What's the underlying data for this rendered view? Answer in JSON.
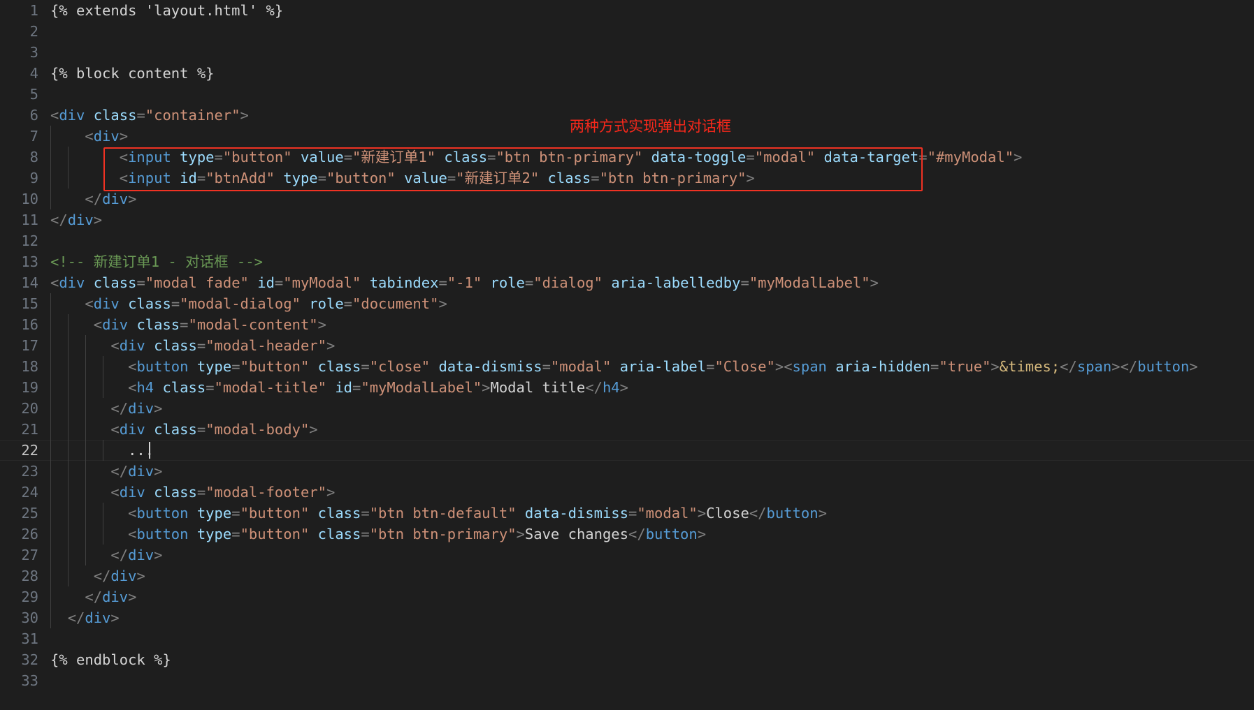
{
  "editor": {
    "theme_background": "#1e1e1e",
    "active_line_number": 22,
    "first_line": 1,
    "last_line": 33,
    "font_size_px": 20.5,
    "line_height_px": 30
  },
  "annotation": {
    "text": "两种方式实现弹出对话框",
    "color": "#f5281b",
    "box_color": "#f03223",
    "box_covers_lines": [
      8,
      9
    ]
  },
  "lines": [
    {
      "n": "1",
      "segments": [
        {
          "t": "{% extends 'layout.html' %}",
          "c": "jinja"
        }
      ]
    },
    {
      "n": "2",
      "segments": []
    },
    {
      "n": "3",
      "segments": []
    },
    {
      "n": "4",
      "segments": [
        {
          "t": "{% block content %}",
          "c": "jinja"
        }
      ]
    },
    {
      "n": "5",
      "segments": []
    },
    {
      "n": "6",
      "segments": [
        {
          "t": "<",
          "c": "punct"
        },
        {
          "t": "div",
          "c": "tag"
        },
        {
          "t": " ",
          "c": "txt"
        },
        {
          "t": "class",
          "c": "attr"
        },
        {
          "t": "=",
          "c": "punct"
        },
        {
          "t": "\"container\"",
          "c": "str"
        },
        {
          "t": ">",
          "c": "punct"
        }
      ]
    },
    {
      "n": "7",
      "segments": [
        {
          "t": "    ",
          "c": "txt"
        },
        {
          "t": "<",
          "c": "punct"
        },
        {
          "t": "div",
          "c": "tag"
        },
        {
          "t": ">",
          "c": "punct"
        }
      ]
    },
    {
      "n": "8",
      "segments": [
        {
          "t": "        ",
          "c": "txt"
        },
        {
          "t": "<",
          "c": "punct"
        },
        {
          "t": "input",
          "c": "tag"
        },
        {
          "t": " ",
          "c": "txt"
        },
        {
          "t": "type",
          "c": "attr"
        },
        {
          "t": "=",
          "c": "punct"
        },
        {
          "t": "\"button\"",
          "c": "str"
        },
        {
          "t": " ",
          "c": "txt"
        },
        {
          "t": "value",
          "c": "attr"
        },
        {
          "t": "=",
          "c": "punct"
        },
        {
          "t": "\"新建订单1\"",
          "c": "str"
        },
        {
          "t": " ",
          "c": "txt"
        },
        {
          "t": "class",
          "c": "attr"
        },
        {
          "t": "=",
          "c": "punct"
        },
        {
          "t": "\"btn btn-primary\"",
          "c": "str"
        },
        {
          "t": " ",
          "c": "txt"
        },
        {
          "t": "data-toggle",
          "c": "attr"
        },
        {
          "t": "=",
          "c": "punct"
        },
        {
          "t": "\"modal\"",
          "c": "str"
        },
        {
          "t": " ",
          "c": "txt"
        },
        {
          "t": "data-target",
          "c": "attr"
        },
        {
          "t": "=",
          "c": "punct"
        },
        {
          "t": "\"#myModal\"",
          "c": "str"
        },
        {
          "t": ">",
          "c": "punct"
        }
      ]
    },
    {
      "n": "9",
      "segments": [
        {
          "t": "        ",
          "c": "txt"
        },
        {
          "t": "<",
          "c": "punct"
        },
        {
          "t": "input",
          "c": "tag"
        },
        {
          "t": " ",
          "c": "txt"
        },
        {
          "t": "id",
          "c": "attr"
        },
        {
          "t": "=",
          "c": "punct"
        },
        {
          "t": "\"btnAdd\"",
          "c": "str"
        },
        {
          "t": " ",
          "c": "txt"
        },
        {
          "t": "type",
          "c": "attr"
        },
        {
          "t": "=",
          "c": "punct"
        },
        {
          "t": "\"button\"",
          "c": "str"
        },
        {
          "t": " ",
          "c": "txt"
        },
        {
          "t": "value",
          "c": "attr"
        },
        {
          "t": "=",
          "c": "punct"
        },
        {
          "t": "\"新建订单2\"",
          "c": "str"
        },
        {
          "t": " ",
          "c": "txt"
        },
        {
          "t": "class",
          "c": "attr"
        },
        {
          "t": "=",
          "c": "punct"
        },
        {
          "t": "\"btn btn-primary\"",
          "c": "str"
        },
        {
          "t": ">",
          "c": "punct"
        }
      ]
    },
    {
      "n": "10",
      "segments": [
        {
          "t": "    ",
          "c": "txt"
        },
        {
          "t": "</",
          "c": "punct"
        },
        {
          "t": "div",
          "c": "tag"
        },
        {
          "t": ">",
          "c": "punct"
        }
      ]
    },
    {
      "n": "11",
      "segments": [
        {
          "t": "</",
          "c": "punct"
        },
        {
          "t": "div",
          "c": "tag"
        },
        {
          "t": ">",
          "c": "punct"
        }
      ]
    },
    {
      "n": "12",
      "segments": []
    },
    {
      "n": "13",
      "segments": [
        {
          "t": "<!-- 新建订单1 - 对话框 -->",
          "c": "comment"
        }
      ]
    },
    {
      "n": "14",
      "segments": [
        {
          "t": "<",
          "c": "punct"
        },
        {
          "t": "div",
          "c": "tag"
        },
        {
          "t": " ",
          "c": "txt"
        },
        {
          "t": "class",
          "c": "attr"
        },
        {
          "t": "=",
          "c": "punct"
        },
        {
          "t": "\"modal fade\"",
          "c": "str"
        },
        {
          "t": " ",
          "c": "txt"
        },
        {
          "t": "id",
          "c": "attr"
        },
        {
          "t": "=",
          "c": "punct"
        },
        {
          "t": "\"myModal\"",
          "c": "str"
        },
        {
          "t": " ",
          "c": "txt"
        },
        {
          "t": "tabindex",
          "c": "attr"
        },
        {
          "t": "=",
          "c": "punct"
        },
        {
          "t": "\"-1\"",
          "c": "str"
        },
        {
          "t": " ",
          "c": "txt"
        },
        {
          "t": "role",
          "c": "attr"
        },
        {
          "t": "=",
          "c": "punct"
        },
        {
          "t": "\"dialog\"",
          "c": "str"
        },
        {
          "t": " ",
          "c": "txt"
        },
        {
          "t": "aria-labelledby",
          "c": "attr"
        },
        {
          "t": "=",
          "c": "punct"
        },
        {
          "t": "\"myModalLabel\"",
          "c": "str"
        },
        {
          "t": ">",
          "c": "punct"
        }
      ]
    },
    {
      "n": "15",
      "segments": [
        {
          "t": "    ",
          "c": "txt"
        },
        {
          "t": "<",
          "c": "punct"
        },
        {
          "t": "div",
          "c": "tag"
        },
        {
          "t": " ",
          "c": "txt"
        },
        {
          "t": "class",
          "c": "attr"
        },
        {
          "t": "=",
          "c": "punct"
        },
        {
          "t": "\"modal-dialog\"",
          "c": "str"
        },
        {
          "t": " ",
          "c": "txt"
        },
        {
          "t": "role",
          "c": "attr"
        },
        {
          "t": "=",
          "c": "punct"
        },
        {
          "t": "\"document\"",
          "c": "str"
        },
        {
          "t": ">",
          "c": "punct"
        }
      ]
    },
    {
      "n": "16",
      "segments": [
        {
          "t": "     ",
          "c": "txt"
        },
        {
          "t": "<",
          "c": "punct"
        },
        {
          "t": "div",
          "c": "tag"
        },
        {
          "t": " ",
          "c": "txt"
        },
        {
          "t": "class",
          "c": "attr"
        },
        {
          "t": "=",
          "c": "punct"
        },
        {
          "t": "\"modal-content\"",
          "c": "str"
        },
        {
          "t": ">",
          "c": "punct"
        }
      ]
    },
    {
      "n": "17",
      "segments": [
        {
          "t": "       ",
          "c": "txt"
        },
        {
          "t": "<",
          "c": "punct"
        },
        {
          "t": "div",
          "c": "tag"
        },
        {
          "t": " ",
          "c": "txt"
        },
        {
          "t": "class",
          "c": "attr"
        },
        {
          "t": "=",
          "c": "punct"
        },
        {
          "t": "\"modal-header\"",
          "c": "str"
        },
        {
          "t": ">",
          "c": "punct"
        }
      ]
    },
    {
      "n": "18",
      "segments": [
        {
          "t": "         ",
          "c": "txt"
        },
        {
          "t": "<",
          "c": "punct"
        },
        {
          "t": "button",
          "c": "tag"
        },
        {
          "t": " ",
          "c": "txt"
        },
        {
          "t": "type",
          "c": "attr"
        },
        {
          "t": "=",
          "c": "punct"
        },
        {
          "t": "\"button\"",
          "c": "str"
        },
        {
          "t": " ",
          "c": "txt"
        },
        {
          "t": "class",
          "c": "attr"
        },
        {
          "t": "=",
          "c": "punct"
        },
        {
          "t": "\"close\"",
          "c": "str"
        },
        {
          "t": " ",
          "c": "txt"
        },
        {
          "t": "data-dismiss",
          "c": "attr"
        },
        {
          "t": "=",
          "c": "punct"
        },
        {
          "t": "\"modal\"",
          "c": "str"
        },
        {
          "t": " ",
          "c": "txt"
        },
        {
          "t": "aria-label",
          "c": "attr"
        },
        {
          "t": "=",
          "c": "punct"
        },
        {
          "t": "\"Close\"",
          "c": "str"
        },
        {
          "t": ">",
          "c": "punct"
        },
        {
          "t": "<",
          "c": "punct"
        },
        {
          "t": "span",
          "c": "tag"
        },
        {
          "t": " ",
          "c": "txt"
        },
        {
          "t": "aria-hidden",
          "c": "attr"
        },
        {
          "t": "=",
          "c": "punct"
        },
        {
          "t": "\"true\"",
          "c": "str"
        },
        {
          "t": ">",
          "c": "punct"
        },
        {
          "t": "&times;",
          "c": "entity"
        },
        {
          "t": "</",
          "c": "punct"
        },
        {
          "t": "span",
          "c": "tag"
        },
        {
          "t": ">",
          "c": "punct"
        },
        {
          "t": "</",
          "c": "punct"
        },
        {
          "t": "button",
          "c": "tag"
        },
        {
          "t": ">",
          "c": "punct"
        }
      ]
    },
    {
      "n": "19",
      "segments": [
        {
          "t": "         ",
          "c": "txt"
        },
        {
          "t": "<",
          "c": "punct"
        },
        {
          "t": "h4",
          "c": "tag"
        },
        {
          "t": " ",
          "c": "txt"
        },
        {
          "t": "class",
          "c": "attr"
        },
        {
          "t": "=",
          "c": "punct"
        },
        {
          "t": "\"modal-title\"",
          "c": "str"
        },
        {
          "t": " ",
          "c": "txt"
        },
        {
          "t": "id",
          "c": "attr"
        },
        {
          "t": "=",
          "c": "punct"
        },
        {
          "t": "\"myModalLabel\"",
          "c": "str"
        },
        {
          "t": ">",
          "c": "punct"
        },
        {
          "t": "Modal title",
          "c": "txt"
        },
        {
          "t": "</",
          "c": "punct"
        },
        {
          "t": "h4",
          "c": "tag"
        },
        {
          "t": ">",
          "c": "punct"
        }
      ]
    },
    {
      "n": "20",
      "segments": [
        {
          "t": "       ",
          "c": "txt"
        },
        {
          "t": "</",
          "c": "punct"
        },
        {
          "t": "div",
          "c": "tag"
        },
        {
          "t": ">",
          "c": "punct"
        }
      ]
    },
    {
      "n": "21",
      "segments": [
        {
          "t": "       ",
          "c": "txt"
        },
        {
          "t": "<",
          "c": "punct"
        },
        {
          "t": "div",
          "c": "tag"
        },
        {
          "t": " ",
          "c": "txt"
        },
        {
          "t": "class",
          "c": "attr"
        },
        {
          "t": "=",
          "c": "punct"
        },
        {
          "t": "\"modal-body\"",
          "c": "str"
        },
        {
          "t": ">",
          "c": "punct"
        }
      ]
    },
    {
      "n": "22",
      "segments": [
        {
          "t": "         ...",
          "c": "txt"
        }
      ],
      "active": true
    },
    {
      "n": "23",
      "segments": [
        {
          "t": "       ",
          "c": "txt"
        },
        {
          "t": "</",
          "c": "punct"
        },
        {
          "t": "div",
          "c": "tag"
        },
        {
          "t": ">",
          "c": "punct"
        }
      ]
    },
    {
      "n": "24",
      "segments": [
        {
          "t": "       ",
          "c": "txt"
        },
        {
          "t": "<",
          "c": "punct"
        },
        {
          "t": "div",
          "c": "tag"
        },
        {
          "t": " ",
          "c": "txt"
        },
        {
          "t": "class",
          "c": "attr"
        },
        {
          "t": "=",
          "c": "punct"
        },
        {
          "t": "\"modal-footer\"",
          "c": "str"
        },
        {
          "t": ">",
          "c": "punct"
        }
      ]
    },
    {
      "n": "25",
      "segments": [
        {
          "t": "         ",
          "c": "txt"
        },
        {
          "t": "<",
          "c": "punct"
        },
        {
          "t": "button",
          "c": "tag"
        },
        {
          "t": " ",
          "c": "txt"
        },
        {
          "t": "type",
          "c": "attr"
        },
        {
          "t": "=",
          "c": "punct"
        },
        {
          "t": "\"button\"",
          "c": "str"
        },
        {
          "t": " ",
          "c": "txt"
        },
        {
          "t": "class",
          "c": "attr"
        },
        {
          "t": "=",
          "c": "punct"
        },
        {
          "t": "\"btn btn-default\"",
          "c": "str"
        },
        {
          "t": " ",
          "c": "txt"
        },
        {
          "t": "data-dismiss",
          "c": "attr"
        },
        {
          "t": "=",
          "c": "punct"
        },
        {
          "t": "\"modal\"",
          "c": "str"
        },
        {
          "t": ">",
          "c": "punct"
        },
        {
          "t": "Close",
          "c": "txt"
        },
        {
          "t": "</",
          "c": "punct"
        },
        {
          "t": "button",
          "c": "tag"
        },
        {
          "t": ">",
          "c": "punct"
        }
      ]
    },
    {
      "n": "26",
      "segments": [
        {
          "t": "         ",
          "c": "txt"
        },
        {
          "t": "<",
          "c": "punct"
        },
        {
          "t": "button",
          "c": "tag"
        },
        {
          "t": " ",
          "c": "txt"
        },
        {
          "t": "type",
          "c": "attr"
        },
        {
          "t": "=",
          "c": "punct"
        },
        {
          "t": "\"button\"",
          "c": "str"
        },
        {
          "t": " ",
          "c": "txt"
        },
        {
          "t": "class",
          "c": "attr"
        },
        {
          "t": "=",
          "c": "punct"
        },
        {
          "t": "\"btn btn-primary\"",
          "c": "str"
        },
        {
          "t": ">",
          "c": "punct"
        },
        {
          "t": "Save changes",
          "c": "txt"
        },
        {
          "t": "</",
          "c": "punct"
        },
        {
          "t": "button",
          "c": "tag"
        },
        {
          "t": ">",
          "c": "punct"
        }
      ]
    },
    {
      "n": "27",
      "segments": [
        {
          "t": "       ",
          "c": "txt"
        },
        {
          "t": "</",
          "c": "punct"
        },
        {
          "t": "div",
          "c": "tag"
        },
        {
          "t": ">",
          "c": "punct"
        }
      ]
    },
    {
      "n": "28",
      "segments": [
        {
          "t": "     ",
          "c": "txt"
        },
        {
          "t": "</",
          "c": "punct"
        },
        {
          "t": "div",
          "c": "tag"
        },
        {
          "t": ">",
          "c": "punct"
        }
      ]
    },
    {
      "n": "29",
      "segments": [
        {
          "t": "    ",
          "c": "txt"
        },
        {
          "t": "</",
          "c": "punct"
        },
        {
          "t": "div",
          "c": "tag"
        },
        {
          "t": ">",
          "c": "punct"
        }
      ]
    },
    {
      "n": "30",
      "segments": [
        {
          "t": "  ",
          "c": "txt"
        },
        {
          "t": "</",
          "c": "punct"
        },
        {
          "t": "div",
          "c": "tag"
        },
        {
          "t": ">",
          "c": "punct"
        }
      ]
    },
    {
      "n": "31",
      "segments": []
    },
    {
      "n": "32",
      "segments": [
        {
          "t": "{% endblock %}",
          "c": "jinja"
        }
      ]
    },
    {
      "n": "33",
      "segments": []
    }
  ],
  "indent_guides": {
    "lines": {
      "7": [
        72
      ],
      "8": [
        72,
        97
      ],
      "9": [
        72,
        97
      ],
      "10": [
        72
      ],
      "15": [
        72
      ],
      "16": [
        72,
        97
      ],
      "17": [
        72,
        97,
        122
      ],
      "18": [
        72,
        97,
        122,
        147
      ],
      "19": [
        72,
        97,
        122,
        147
      ],
      "20": [
        72,
        97,
        122
      ],
      "21": [
        72,
        97,
        122
      ],
      "22": [
        72,
        97,
        122,
        147
      ],
      "23": [
        72,
        97,
        122
      ],
      "24": [
        72,
        97,
        122
      ],
      "25": [
        72,
        97,
        122,
        147
      ],
      "26": [
        72,
        97,
        122,
        147
      ],
      "27": [
        72,
        97,
        122
      ],
      "28": [
        72,
        97
      ],
      "29": [
        72
      ],
      "30": [
        72
      ]
    }
  }
}
